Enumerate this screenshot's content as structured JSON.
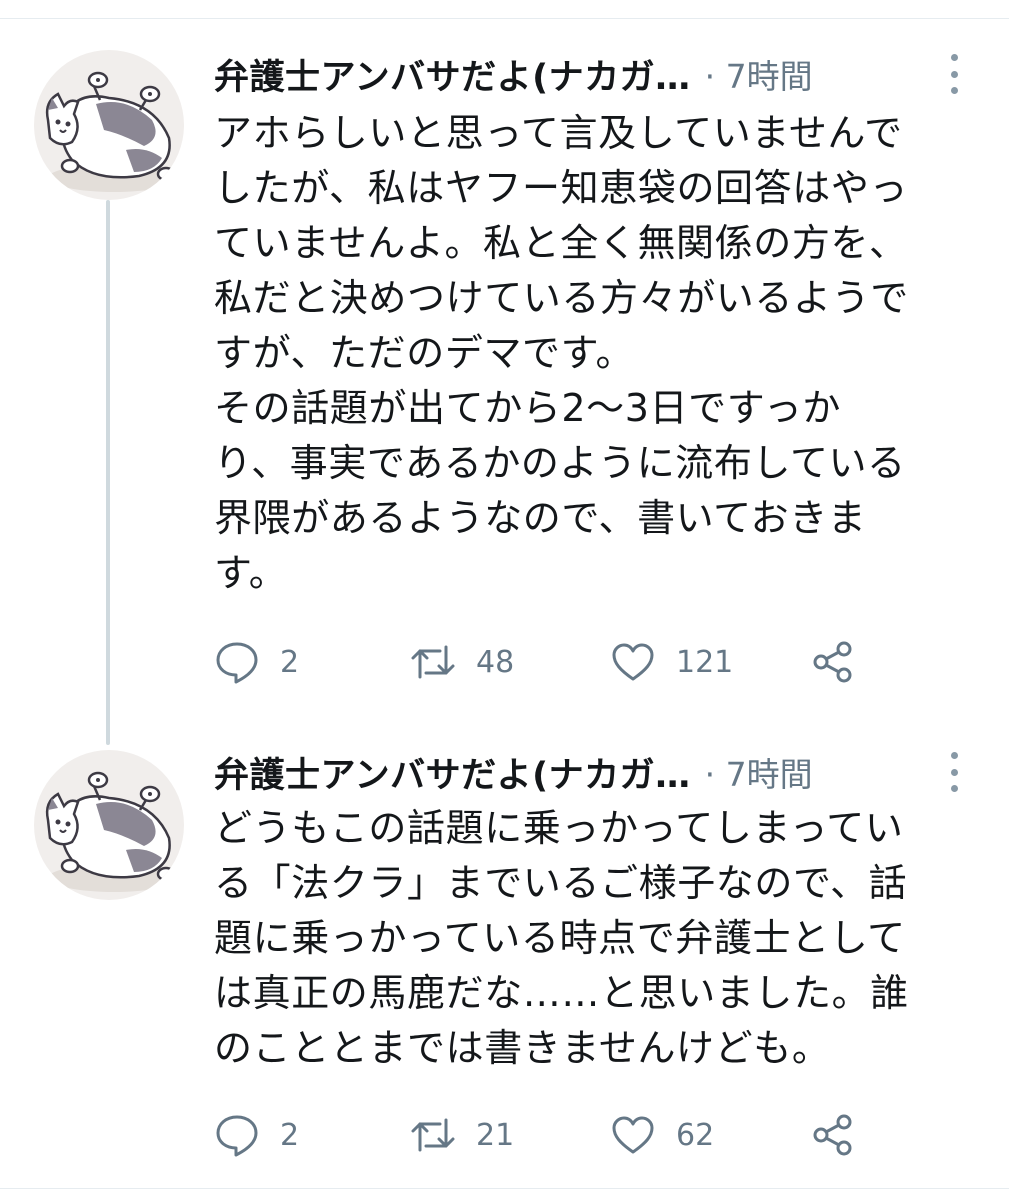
{
  "tweets": [
    {
      "author": "弁護士アンバサだよ(ナカガ…",
      "time": "· 7時間",
      "text": "アホらしいと思って言及していませんで\nしたが、私はヤフー知恵袋の回答はやっ\nていませんよ。私と全く無関係の方を、\n私だと決めつけている方々がいるようで\nすが、ただのデマです。\nその話題が出てから2〜3日ですっか\nり、事実であるかのように流布している\n界隈があるようなので、書いておきま\nす。",
      "replies": "2",
      "retweets": "48",
      "likes": "121"
    },
    {
      "author": "弁護士アンバサだよ(ナカガ…",
      "time": "· 7時間",
      "text": "どうもこの話題に乗っかってしまってい\nる「法クラ」までいるご様子なので、話\n題に乗っかっている時点で弁護士として\nは真正の馬鹿だな……と思いました。誰\nのこととまでは書きませんけども。",
      "replies": "2",
      "retweets": "21",
      "likes": "62"
    }
  ],
  "icons": {
    "reply": "speech-bubble-icon",
    "retweet": "retweet-arrows-icon",
    "like": "heart-icon",
    "share": "share-nodes-icon",
    "more": "vertical-ellipsis-icon"
  },
  "colors": {
    "text": "#14171a",
    "secondary": "#657786",
    "thread_line": "#cfd9de",
    "divider": "#e6ecf0"
  }
}
